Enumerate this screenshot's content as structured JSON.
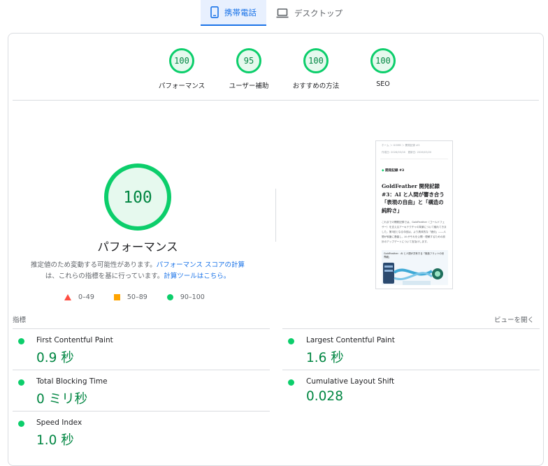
{
  "device_tabs": [
    {
      "label": "携帯電話",
      "icon": "smartphone-icon",
      "active": true
    },
    {
      "label": "デスクトップ",
      "icon": "laptop-icon",
      "active": false
    }
  ],
  "colors": {
    "good": "#0cce6b",
    "good_text": "#018642",
    "good_fill": "#e6f9ee",
    "average": "#ffa400",
    "poor": "#ff4e42",
    "link": "#1a73e8"
  },
  "categories": [
    {
      "score": "100",
      "label": "パフォーマンス"
    },
    {
      "score": "95",
      "label": "ユーザー補助"
    },
    {
      "score": "100",
      "label": "おすすめの方法"
    },
    {
      "score": "100",
      "label": "SEO"
    }
  ],
  "performance": {
    "score": "100",
    "title": "パフォーマンス",
    "note_prefix": "推定値のため変動する可能性があります。",
    "note_link1": "パフォーマンス スコアの計算",
    "note_middle": "は、これらの指標を基に行っています。",
    "note_link2": "計算ツールはこちら。"
  },
  "legend": [
    {
      "range": "0–49",
      "shape": "triangle"
    },
    {
      "range": "50–89",
      "shape": "square"
    },
    {
      "range": "90–100",
      "shape": "circle"
    }
  ],
  "screenshot": {
    "breadcrumb": "ホーム ＞ GOMB ＞ 開発記録 #3",
    "meta": "作成日: 2026/03/16　更新日: 2026/03/20",
    "chip": "開発記録 #3",
    "headline": "GoldFeather 開発記録 #3：AI と人間が響き合う「表現の自由」と「構造の純粋さ」",
    "body": "これまでの開発記録では、GoldFeather（ゴールドフェザー）を支えるアーキテクチャの背景について触れてきました。第3回となる今回は、より具体的な「進化」――人間が執筆に基盤し、AI がそれを公開・理解するための設計のアップデートについて言及けします。",
    "figure_caption": "GoldFeather：AI と人間が共有する「構造フラットの世界観」"
  },
  "metrics_section": {
    "heading": "指標",
    "expand_label": "ビューを開く"
  },
  "metrics": [
    {
      "name": "First Contentful Paint",
      "value": "0.9 秒"
    },
    {
      "name": "Largest Contentful Paint",
      "value": "1.6 秒"
    },
    {
      "name": "Total Blocking Time",
      "value": "0 ミリ秒"
    },
    {
      "name": "Cumulative Layout Shift",
      "value": "0.028"
    },
    {
      "name": "Speed Index",
      "value": "1.0 秒"
    }
  ]
}
